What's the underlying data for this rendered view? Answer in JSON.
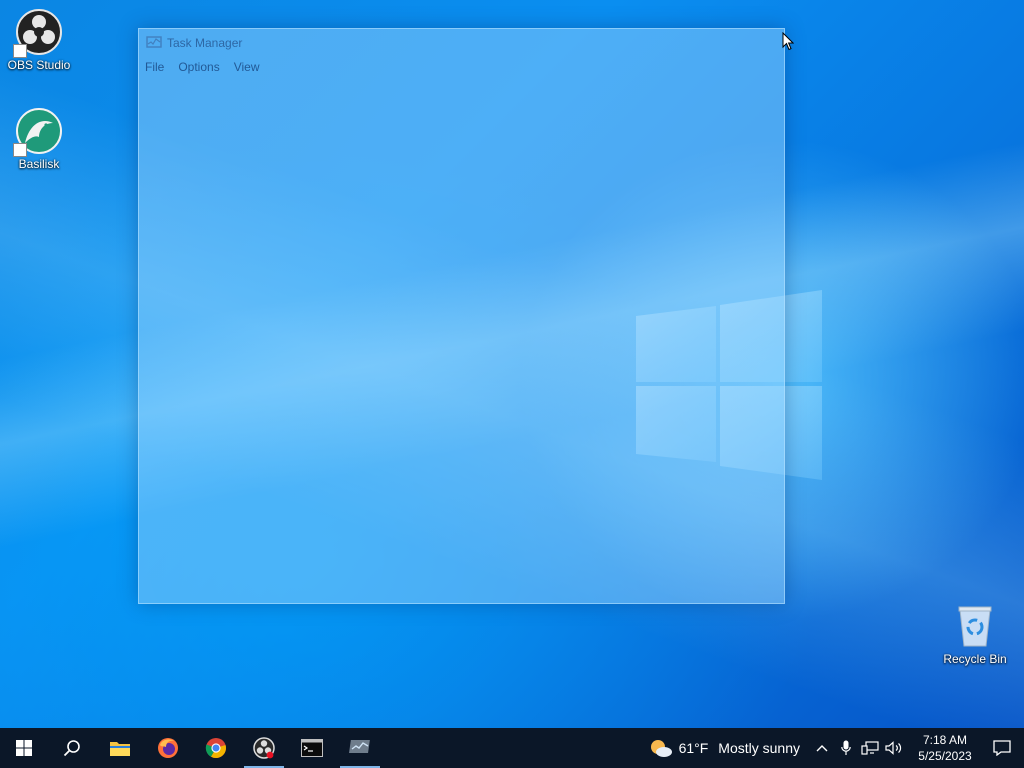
{
  "desktop": {
    "icons": [
      {
        "label": "OBS Studio"
      },
      {
        "label": "Basilisk"
      },
      {
        "label": "Recycle Bin"
      }
    ]
  },
  "task_manager": {
    "title": "Task Manager",
    "menu": [
      "File",
      "Options",
      "View"
    ]
  },
  "taskbar": {
    "apps": [
      {
        "name": "start-icon"
      },
      {
        "name": "search-icon"
      },
      {
        "name": "file-explorer-icon"
      },
      {
        "name": "firefox-icon"
      },
      {
        "name": "chrome-icon"
      },
      {
        "name": "obs-studio-icon"
      },
      {
        "name": "terminal-icon"
      },
      {
        "name": "task-manager-icon"
      }
    ],
    "weather": {
      "temperature": "61°F",
      "condition": "Mostly sunny"
    },
    "clock": {
      "time": "7:18 AM",
      "date": "5/25/2023"
    }
  },
  "colors": {
    "taskbar_bg": "#0b1728",
    "accent": "#0a74d8",
    "active_indicator": "#7fb5e8"
  }
}
